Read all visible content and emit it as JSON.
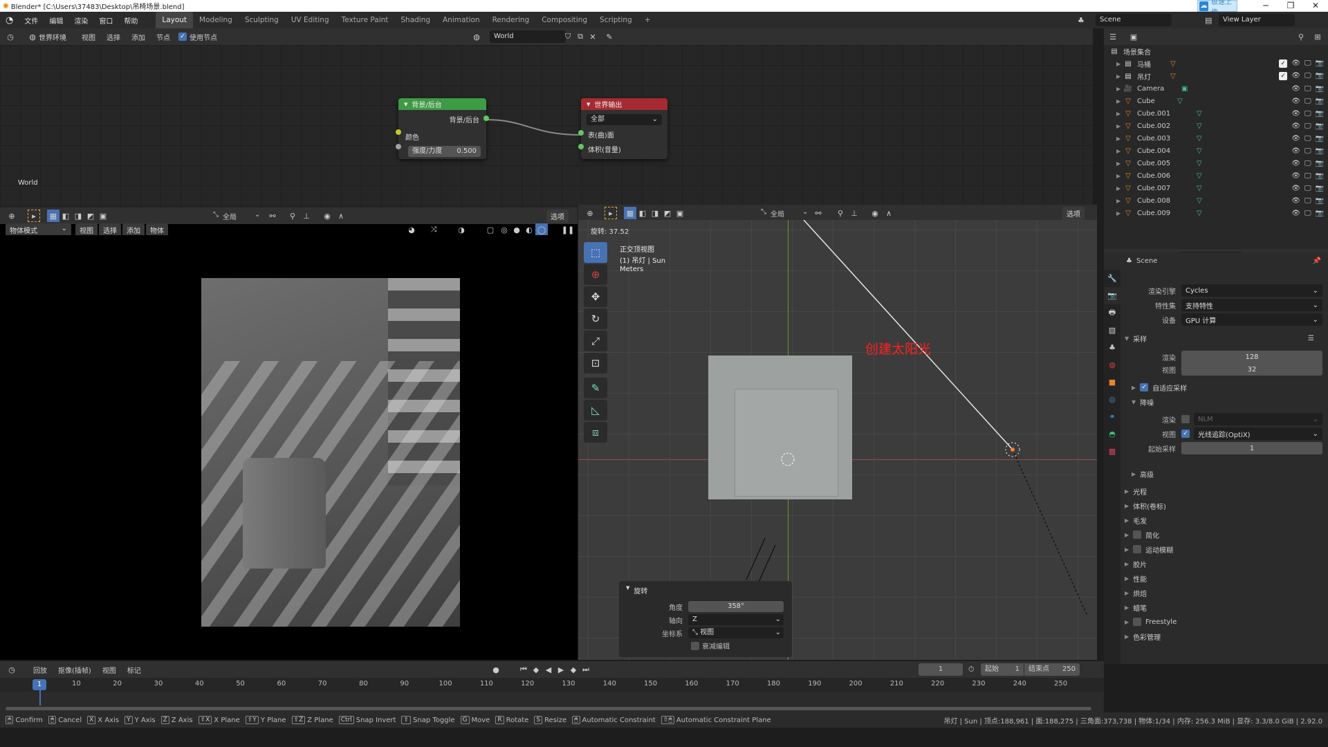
{
  "titlebar": {
    "title": "Blender* [C:\\Users\\37483\\Desktop\\吊椅场景.blend]",
    "upload_label": "极速上传",
    "minimize": "─",
    "maximize": "❐",
    "close": "✕"
  },
  "menubar": {
    "menus": [
      "文件",
      "编辑",
      "渲染",
      "窗口",
      "帮助"
    ],
    "workspaces": [
      "Layout",
      "Modeling",
      "Sculpting",
      "UV Editing",
      "Texture Paint",
      "Shading",
      "Animation",
      "Rendering",
      "Compositing",
      "Scripting"
    ],
    "active_workspace": "Layout",
    "add_workspace": "+",
    "scene_label": "Scene",
    "view_layer_label": "View Layer"
  },
  "node_editor": {
    "header": {
      "type_dropdown": "世界环境",
      "menus": [
        "视图",
        "选择",
        "添加",
        "节点"
      ],
      "use_nodes_label": "使用节点",
      "world_name": "World"
    },
    "world_label": "World",
    "background_node": {
      "title": "背景/后台",
      "output_label": "背景/后台",
      "color_label": "颜色",
      "strength_label": "强度/力度",
      "strength_value": "0.500",
      "header_color": "#3f9a45"
    },
    "output_node": {
      "title": "世界输出",
      "target": "全部",
      "surface_label": "表(曲)面",
      "volume_label": "体积(音量)",
      "header_color": "#a62a32"
    }
  },
  "render_viewport": {
    "header": {
      "transform_orientation": "全局",
      "options_label": "选项",
      "mode": "物体模式",
      "menus": [
        "视图",
        "选择",
        "添加",
        "物体"
      ]
    }
  },
  "viewport_3d": {
    "header": {
      "transform_orientation": "全局",
      "options_label": "选项"
    },
    "rotation_readout": "旋转: 37.52",
    "view_name": "正交顶视图",
    "object_info": "(1) 吊灯 | Sun",
    "units": "Meters",
    "annotation": "创建太阳光",
    "annotation_color": "#ff2020",
    "tools": [
      "select-box",
      "cursor",
      "move",
      "rotate",
      "scale",
      "transform",
      "annotate",
      "measure",
      "add-cube"
    ]
  },
  "redo_panel": {
    "title": "旋转",
    "angle_label": "角度",
    "angle_value": "358°",
    "axis_label": "轴向",
    "axis_value": "Z",
    "orientation_label": "坐标系",
    "orientation_value": "视图",
    "proportional_label": "衰减编辑"
  },
  "outliner": {
    "root": "场景集合",
    "items": [
      {
        "name": "马桶",
        "type": "collection",
        "checked": true
      },
      {
        "name": "吊灯",
        "type": "collection",
        "checked": true
      },
      {
        "name": "Camera",
        "type": "camera"
      },
      {
        "name": "Cube",
        "type": "mesh"
      },
      {
        "name": "Cube.001",
        "type": "mesh"
      },
      {
        "name": "Cube.002",
        "type": "mesh"
      },
      {
        "name": "Cube.003",
        "type": "mesh"
      },
      {
        "name": "Cube.004",
        "type": "mesh"
      },
      {
        "name": "Cube.005",
        "type": "mesh"
      },
      {
        "name": "Cube.006",
        "type": "mesh"
      },
      {
        "name": "Cube.007",
        "type": "mesh"
      },
      {
        "name": "Cube.008",
        "type": "mesh"
      },
      {
        "name": "Cube.009",
        "type": "mesh"
      }
    ]
  },
  "properties": {
    "context": "Scene",
    "render_engine_label": "渲染引擎",
    "render_engine": "Cycles",
    "feature_set_label": "特性集",
    "feature_set": "支持特性",
    "device_label": "设备",
    "device": "GPU 计算",
    "sampling": {
      "title": "采样",
      "render_label": "渲染",
      "render_value": "128",
      "viewport_label": "视图",
      "viewport_value": "32",
      "adaptive_label": "自适应采样",
      "denoise_title": "降噪",
      "denoise_render_label": "渲染",
      "denoise_render_value": "NLM",
      "denoise_view_label": "视图",
      "denoise_view_value": "光线追踪(OptiX)",
      "start_sample_label": "起始采样",
      "start_sample_value": "1",
      "advanced_label": "高级"
    },
    "sections": [
      "光程",
      "体积(卷标)",
      "毛发",
      "简化",
      "运动模糊",
      "胶片",
      "性能",
      "烘焙",
      "蜡笔",
      "Freestyle",
      "色彩管理"
    ]
  },
  "timeline": {
    "menus": [
      "回放",
      "抠像(插帧)",
      "视图",
      "标记"
    ],
    "current_frame": "1",
    "start_label": "起始",
    "start_value": "1",
    "end_label": "结束点",
    "end_value": "250",
    "ticks": [
      "1",
      "10",
      "20",
      "30",
      "40",
      "50",
      "60",
      "70",
      "80",
      "90",
      "100",
      "110",
      "120",
      "130",
      "140",
      "150",
      "160",
      "170",
      "180",
      "190",
      "200",
      "210",
      "220",
      "230",
      "240",
      "250"
    ]
  },
  "statusbar": {
    "hints": [
      {
        "key": "🖱",
        "label": "Confirm"
      },
      {
        "key": "🖱",
        "label": "Cancel"
      },
      {
        "key": "X",
        "label": "X Axis"
      },
      {
        "key": "Y",
        "label": "Y Axis"
      },
      {
        "key": "Z",
        "label": "Z Axis"
      },
      {
        "key": "⇧X",
        "label": "X Plane"
      },
      {
        "key": "⇧Y",
        "label": "Y Plane"
      },
      {
        "key": "⇧Z",
        "label": "Z Plane"
      },
      {
        "key": "Ctrl",
        "label": "Snap Invert"
      },
      {
        "key": "⇧",
        "label": "Snap Toggle"
      },
      {
        "key": "G",
        "label": "Move"
      },
      {
        "key": "R",
        "label": "Rotate"
      },
      {
        "key": "S",
        "label": "Resize"
      },
      {
        "key": "🖱",
        "label": "Automatic Constraint"
      },
      {
        "key": "⇧🖱",
        "label": "Automatic Constraint Plane"
      }
    ],
    "stats": "吊灯 | Sun | 顶点:188,961 | 面:188,275 | 三角面:373,738 | 物体:1/34 | 内存: 256.3 MiB | 显存: 3.3/8.0 GiB | 2.92.0"
  }
}
